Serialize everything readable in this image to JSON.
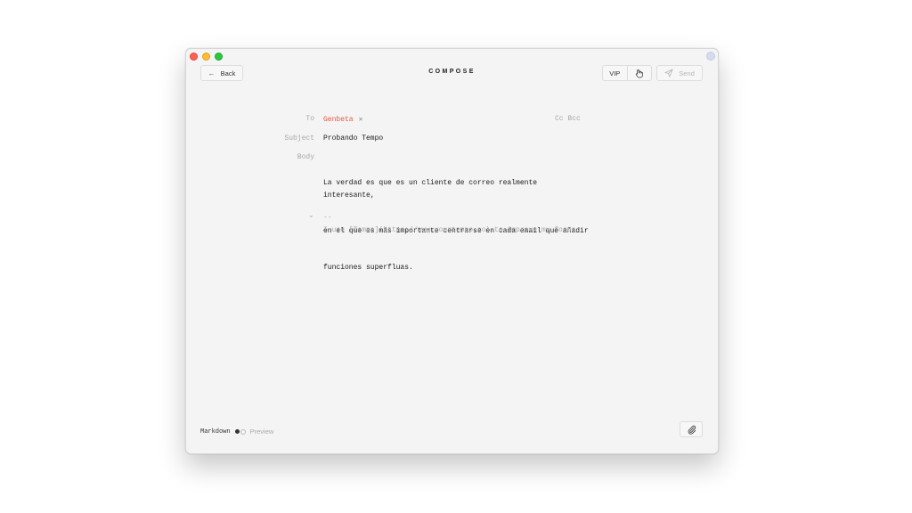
{
  "window": {
    "title": "COMPOSE"
  },
  "toolbar": {
    "back_label": "Back",
    "vip_label": "VIP",
    "send_label": "Send"
  },
  "form": {
    "to_label": "To",
    "to_recipient": "Genbeta",
    "cc_bcc": "Cc Bcc",
    "subject_label": "Subject",
    "subject_value": "Probando Tempo",
    "body_label": "Body",
    "body_lines": [
      "La verdad es que es un cliente de correo realmente interesante,",
      "en el que es más importante centrarse en cada email que añadir",
      "funciones superfluas."
    ],
    "signature_separator": "--",
    "signature_text": "I use [Tempo](https://www.yourtempo.co) to improve my focus"
  },
  "footer": {
    "markdown_label": "Markdown",
    "preview_label": "Preview"
  },
  "colors": {
    "recipient": "#e8553e",
    "window_bg": "#f4f4f4"
  },
  "icons": {
    "back": "arrow-left-icon",
    "hand": "hand-pointer-icon",
    "send": "paper-plane-icon",
    "attach": "paperclip-icon",
    "remove": "close-icon",
    "signature_toggle": "chevron-down-icon"
  }
}
